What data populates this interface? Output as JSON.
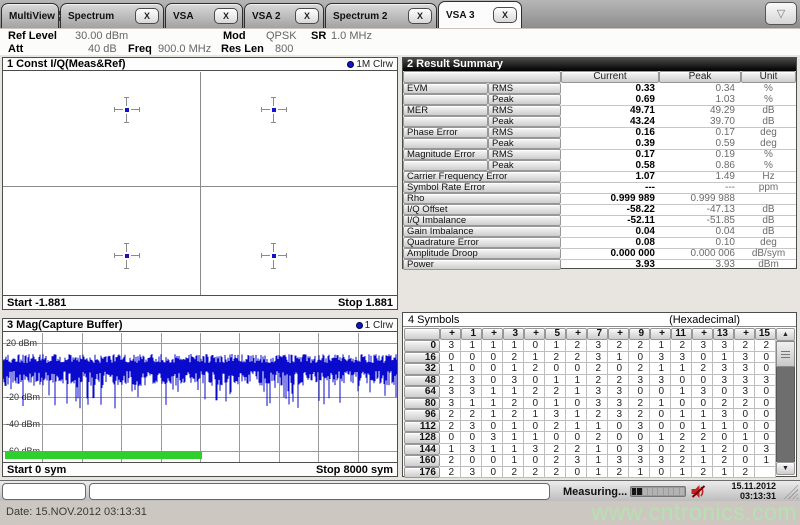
{
  "tabs": {
    "items": [
      {
        "label": "MultiView",
        "icon": "grid-icon",
        "closable": false,
        "active": false
      },
      {
        "label": "Spectrum",
        "closable": true,
        "active": false
      },
      {
        "label": "VSA",
        "closable": true,
        "active": false
      },
      {
        "label": "VSA 2",
        "closable": true,
        "active": false
      },
      {
        "label": "Spectrum 2",
        "closable": true,
        "active": false
      },
      {
        "label": "VSA 3",
        "closable": true,
        "active": true
      }
    ],
    "close_label": "X",
    "overflow_icon": "▽"
  },
  "settings": {
    "ref_level_label": "Ref Level",
    "ref_level_value": "30.00 dBm",
    "att_label": "Att",
    "att_value": "40 dB",
    "freq_label": "Freq",
    "freq_value": "900.0 MHz",
    "mod_label": "Mod",
    "mod_value": "QPSK",
    "sr_label": "SR",
    "sr_value": "1.0 MHz",
    "res_len_label": "Res Len",
    "res_len_value": "800"
  },
  "const_window": {
    "title": "1 Const I/Q(Meas&Ref)",
    "trace_legend": "1M Clrw",
    "start_label": "Start -1.881",
    "stop_label": "Stop 1.881",
    "points": [
      {
        "x": 0.315,
        "y": 0.169
      },
      {
        "x": 0.688,
        "y": 0.169
      },
      {
        "x": 0.315,
        "y": 0.827
      },
      {
        "x": 0.688,
        "y": 0.827
      }
    ]
  },
  "result_summary": {
    "title": "2 Result Summary",
    "columns": [
      "Current",
      "Peak",
      "Unit"
    ],
    "rows": [
      {
        "name": "EVM",
        "sub": "RMS",
        "current": "0.33",
        "peak": "0.34",
        "unit": "%"
      },
      {
        "name": "",
        "sub": "Peak",
        "current": "0.69",
        "peak": "1.03",
        "unit": "%"
      },
      {
        "name": "MER",
        "sub": "RMS",
        "current": "49.71",
        "peak": "49.29",
        "unit": "dB"
      },
      {
        "name": "",
        "sub": "Peak",
        "current": "43.24",
        "peak": "39.70",
        "unit": "dB"
      },
      {
        "name": "Phase Error",
        "sub": "RMS",
        "current": "0.16",
        "peak": "0.17",
        "unit": "deg"
      },
      {
        "name": "",
        "sub": "Peak",
        "current": "0.39",
        "peak": "0.59",
        "unit": "deg"
      },
      {
        "name": "Magnitude Error",
        "sub": "RMS",
        "current": "0.17",
        "peak": "0.19",
        "unit": "%"
      },
      {
        "name": "",
        "sub": "Peak",
        "current": "0.58",
        "peak": "0.86",
        "unit": "%"
      },
      {
        "name": "Carrier Frequency Error",
        "sub": null,
        "current": "1.07",
        "peak": "1.49",
        "unit": "Hz"
      },
      {
        "name": "Symbol Rate Error",
        "sub": null,
        "current": "---",
        "peak": "---",
        "unit": "ppm"
      },
      {
        "name": "Rho",
        "sub": null,
        "current": "0.999 989",
        "peak": "0.999 988",
        "unit": ""
      },
      {
        "name": "I/Q Offset",
        "sub": null,
        "current": "-58.22",
        "peak": "-47.13",
        "unit": "dB"
      },
      {
        "name": "I/Q Imbalance",
        "sub": null,
        "current": "-52.11",
        "peak": "-51.85",
        "unit": "dB"
      },
      {
        "name": "Gain Imbalance",
        "sub": null,
        "current": "0.04",
        "peak": "0.04",
        "unit": "dB"
      },
      {
        "name": "Quadrature Error",
        "sub": null,
        "current": "0.08",
        "peak": "0.10",
        "unit": "deg"
      },
      {
        "name": "Amplitude Droop",
        "sub": null,
        "current": "0.000 000",
        "peak": "0.000 006",
        "unit": "dB/sym"
      },
      {
        "name": "Power",
        "sub": null,
        "current": "3.93",
        "peak": "3.93",
        "unit": "dBm"
      }
    ]
  },
  "capture_window": {
    "title": "3 Mag(Capture Buffer)",
    "trace_legend": "1 Clrw",
    "y_axis_labels": [
      {
        "text": "20 dBm",
        "line": 0
      },
      {
        "text": "-20 dBm",
        "line": 2
      },
      {
        "text": "-40 dBm",
        "line": 3
      },
      {
        "text": "-60 dBm",
        "line": 4
      }
    ],
    "h_gridlines": 5,
    "v_divisions": 10,
    "start_label": "Start 0 sym",
    "stop_label": "Stop 8000 sym",
    "analyzed_fraction": 0.5
  },
  "symbols_window": {
    "title": "4 Symbols",
    "format_label": "(Hexadecimal)",
    "col_headers": [
      "+",
      "1",
      "+",
      "3",
      "+",
      "5",
      "+",
      "7",
      "+",
      "9",
      "+",
      "11",
      "+",
      "13",
      "+",
      "15"
    ],
    "rows": [
      {
        "index": "0",
        "values": [
          "3",
          "1",
          "1",
          "1",
          "0",
          "1",
          "2",
          "3",
          "2",
          "2",
          "1",
          "2",
          "3",
          "3",
          "2",
          "2"
        ]
      },
      {
        "index": "16",
        "values": [
          "0",
          "0",
          "0",
          "2",
          "1",
          "2",
          "2",
          "3",
          "1",
          "0",
          "3",
          "3",
          "0",
          "1",
          "3",
          "0"
        ]
      },
      {
        "index": "32",
        "values": [
          "1",
          "0",
          "0",
          "1",
          "2",
          "0",
          "0",
          "2",
          "0",
          "2",
          "1",
          "1",
          "2",
          "3",
          "3",
          "0"
        ]
      },
      {
        "index": "48",
        "values": [
          "2",
          "3",
          "0",
          "3",
          "0",
          "1",
          "1",
          "2",
          "2",
          "3",
          "3",
          "0",
          "0",
          "3",
          "3",
          "3"
        ]
      },
      {
        "index": "64",
        "values": [
          "3",
          "3",
          "1",
          "1",
          "2",
          "2",
          "1",
          "3",
          "3",
          "0",
          "0",
          "1",
          "3",
          "0",
          "3",
          "0"
        ]
      },
      {
        "index": "80",
        "values": [
          "3",
          "1",
          "1",
          "2",
          "0",
          "1",
          "0",
          "3",
          "3",
          "2",
          "1",
          "0",
          "0",
          "2",
          "2",
          "0"
        ]
      },
      {
        "index": "96",
        "values": [
          "2",
          "2",
          "1",
          "2",
          "1",
          "3",
          "1",
          "2",
          "3",
          "2",
          "0",
          "1",
          "1",
          "3",
          "0",
          "0"
        ]
      },
      {
        "index": "112",
        "values": [
          "2",
          "3",
          "0",
          "1",
          "0",
          "2",
          "1",
          "1",
          "0",
          "3",
          "0",
          "0",
          "1",
          "1",
          "0",
          "0"
        ]
      },
      {
        "index": "128",
        "values": [
          "0",
          "0",
          "3",
          "1",
          "1",
          "0",
          "0",
          "2",
          "0",
          "0",
          "1",
          "2",
          "2",
          "0",
          "1",
          "0"
        ]
      },
      {
        "index": "144",
        "values": [
          "1",
          "3",
          "1",
          "1",
          "3",
          "2",
          "2",
          "1",
          "0",
          "3",
          "0",
          "2",
          "1",
          "2",
          "0",
          "3"
        ]
      },
      {
        "index": "160",
        "values": [
          "2",
          "0",
          "0",
          "1",
          "0",
          "2",
          "3",
          "1",
          "3",
          "3",
          "3",
          "2",
          "1",
          "2",
          "0",
          "1"
        ]
      },
      {
        "index": "176",
        "values": [
          "2",
          "3",
          "0",
          "2",
          "2",
          "2",
          "0",
          "1",
          "2",
          "1",
          "0",
          "1",
          "2",
          "1",
          "2",
          ""
        ]
      }
    ]
  },
  "status_bar": {
    "measuring_label": "Measuring...",
    "progress_total": 10,
    "progress_filled": 2,
    "date": "15.11.2012",
    "time": "03:13:31"
  },
  "footer": {
    "date_line": "Date: 15.NOV.2012  03:13:31",
    "watermark": "www.cntronics.com"
  },
  "colors": {
    "trace_blue": "#0a0acd",
    "analyzed_green": "#2ed02e",
    "watermark_green": "#b7e0b0",
    "mute_red": "#c22222"
  }
}
